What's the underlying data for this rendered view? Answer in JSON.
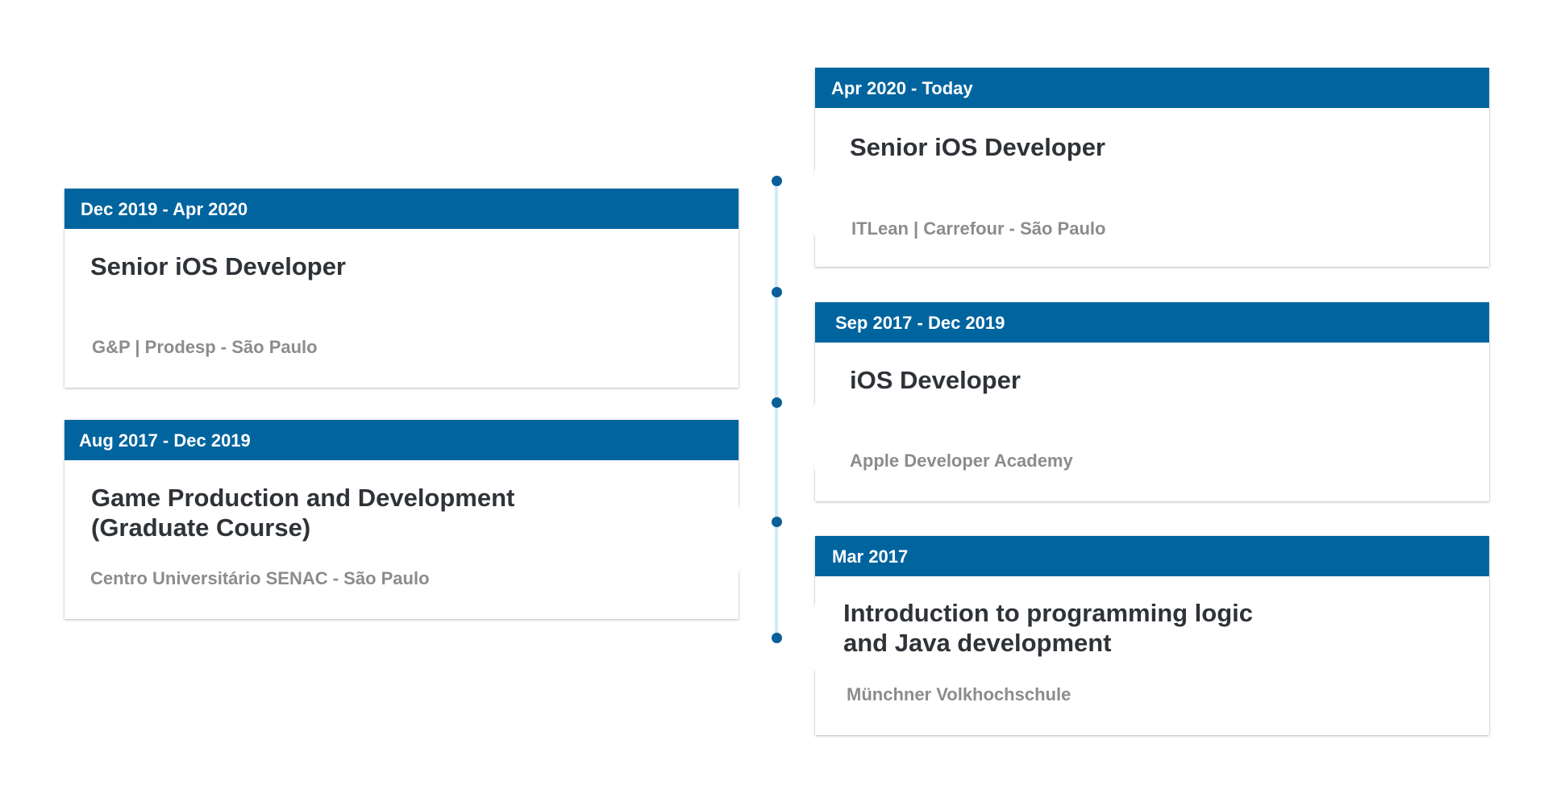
{
  "entries": [
    {
      "date": "Apr 2020 - Today",
      "title": "Senior iOS Developer",
      "organization": "ITLean | Carrefour - São Paulo"
    },
    {
      "date": "Dec 2019 - Apr 2020",
      "title": "Senior iOS Developer",
      "organization": "G&P | Prodesp - São Paulo"
    },
    {
      "date": "Sep 2017 - Dec 2019",
      "title": "iOS Developer",
      "organization": "Apple Developer Academy"
    },
    {
      "date": "Aug 2017 - Dec 2019",
      "title": "Game Production and Development\n(Graduate Course)",
      "organization": "Centro Universitário SENAC - São Paulo"
    },
    {
      "date": "Mar 2017",
      "title": "Introduction to programming logic\nand Java development",
      "organization": "Münchner Volkhochschule"
    }
  ],
  "colors": {
    "header_background": "#00649f",
    "timeline_dot": "#0a5f99",
    "timeline_line": "#cfeaf8",
    "title_text": "#2f3338",
    "organization_text": "#8c8c8c"
  }
}
